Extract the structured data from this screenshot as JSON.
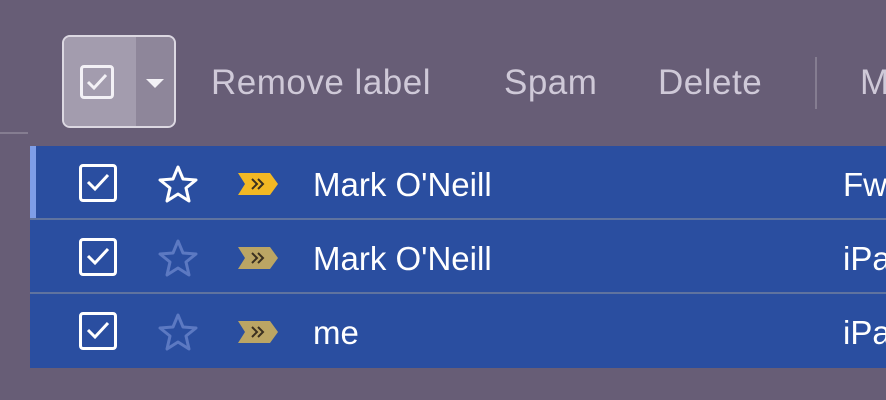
{
  "toolbar": {
    "remove_label": "Remove label",
    "spam": "Spam",
    "delete": "Delete",
    "more_truncated": "M"
  },
  "rows": [
    {
      "sender": "Mark O'Neill",
      "subject_truncated": "Fw",
      "selected": true,
      "starred": true,
      "important_color": "#f2b824"
    },
    {
      "sender": "Mark O'Neill",
      "subject_truncated": "iPa",
      "selected": true,
      "starred": false,
      "important_color": "#bba564"
    },
    {
      "sender": "me",
      "subject_truncated": "iPa",
      "selected": true,
      "starred": false,
      "important_color": "#bba564"
    }
  ],
  "colors": {
    "background": "#675d76",
    "row_selected": "#2a4ea0",
    "toolbar_text": "#cfc9d8"
  },
  "icons": {
    "select_all": "checkbox-checked-icon",
    "select_menu": "caret-down-icon",
    "star": "star-icon",
    "important": "importance-marker-icon"
  }
}
